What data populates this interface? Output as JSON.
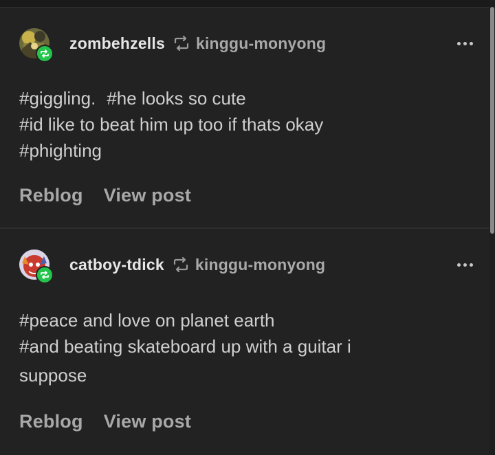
{
  "posts": [
    {
      "username": "zombehzells",
      "source": "kinggu-monyong",
      "avatar_icon": "reblog-badge-icon",
      "tag_lines": [
        [
          "#giggling.",
          "#he looks so cute"
        ],
        [
          "#id like to beat him up too if thats okay"
        ],
        [
          "#phighting"
        ]
      ],
      "actions": {
        "reblog": "Reblog",
        "view": "View post"
      }
    },
    {
      "username": "catboy-tdick",
      "source": "kinggu-monyong",
      "avatar_icon": "reblog-badge-icon",
      "tag_lines": [
        [
          "#peace and love on planet earth"
        ],
        [
          "#and beating skateboard up with a guitar i"
        ]
      ],
      "tag_wrap": "suppose",
      "actions": {
        "reblog": "Reblog",
        "view": "View post"
      }
    }
  ],
  "colors": {
    "background": "#222222",
    "badge": "#23c44b",
    "text": "#cfcfcf",
    "muted": "#a9a9a9"
  }
}
